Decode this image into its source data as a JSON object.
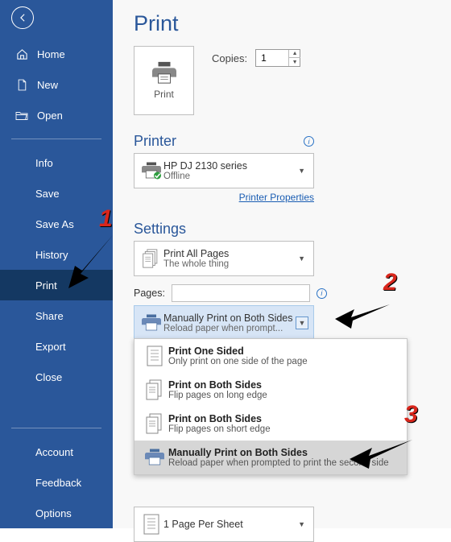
{
  "sidebar": {
    "group1": [
      {
        "label": "Home"
      },
      {
        "label": "New"
      },
      {
        "label": "Open"
      }
    ],
    "group2": [
      {
        "label": "Info"
      },
      {
        "label": "Save"
      },
      {
        "label": "Save As"
      },
      {
        "label": "History"
      },
      {
        "label": "Print"
      },
      {
        "label": "Share"
      },
      {
        "label": "Export"
      },
      {
        "label": "Close"
      }
    ],
    "group3": [
      {
        "label": "Account"
      },
      {
        "label": "Feedback"
      },
      {
        "label": "Options"
      }
    ],
    "active": "Print"
  },
  "main": {
    "title": "Print",
    "print_button": "Print",
    "copies_label": "Copies:",
    "copies_value": "1",
    "printer_heading": "Printer",
    "printer": {
      "name": "HP DJ 2130 series",
      "status": "Offline"
    },
    "printer_properties": "Printer Properties",
    "settings_heading": "Settings",
    "print_all": {
      "line1": "Print All Pages",
      "line2": "The whole thing"
    },
    "pages_label": "Pages:",
    "duplex": {
      "line1": "Manually Print on Both Sides",
      "line2": "Reload paper when prompt..."
    },
    "sheet": {
      "line1": "1 Page Per Sheet"
    }
  },
  "menu": {
    "items": [
      {
        "line1": "Print One Sided",
        "line2": "Only print on one side of the page"
      },
      {
        "line1": "Print on Both Sides",
        "line2": "Flip pages on long edge"
      },
      {
        "line1": "Print on Both Sides",
        "line2": "Flip pages on short edge"
      },
      {
        "line1": "Manually Print on Both Sides",
        "line2": "Reload paper when prompted to print the second side"
      }
    ],
    "selected_index": 3
  },
  "annotations": {
    "n1": "1",
    "n2": "2",
    "n3": "3"
  }
}
